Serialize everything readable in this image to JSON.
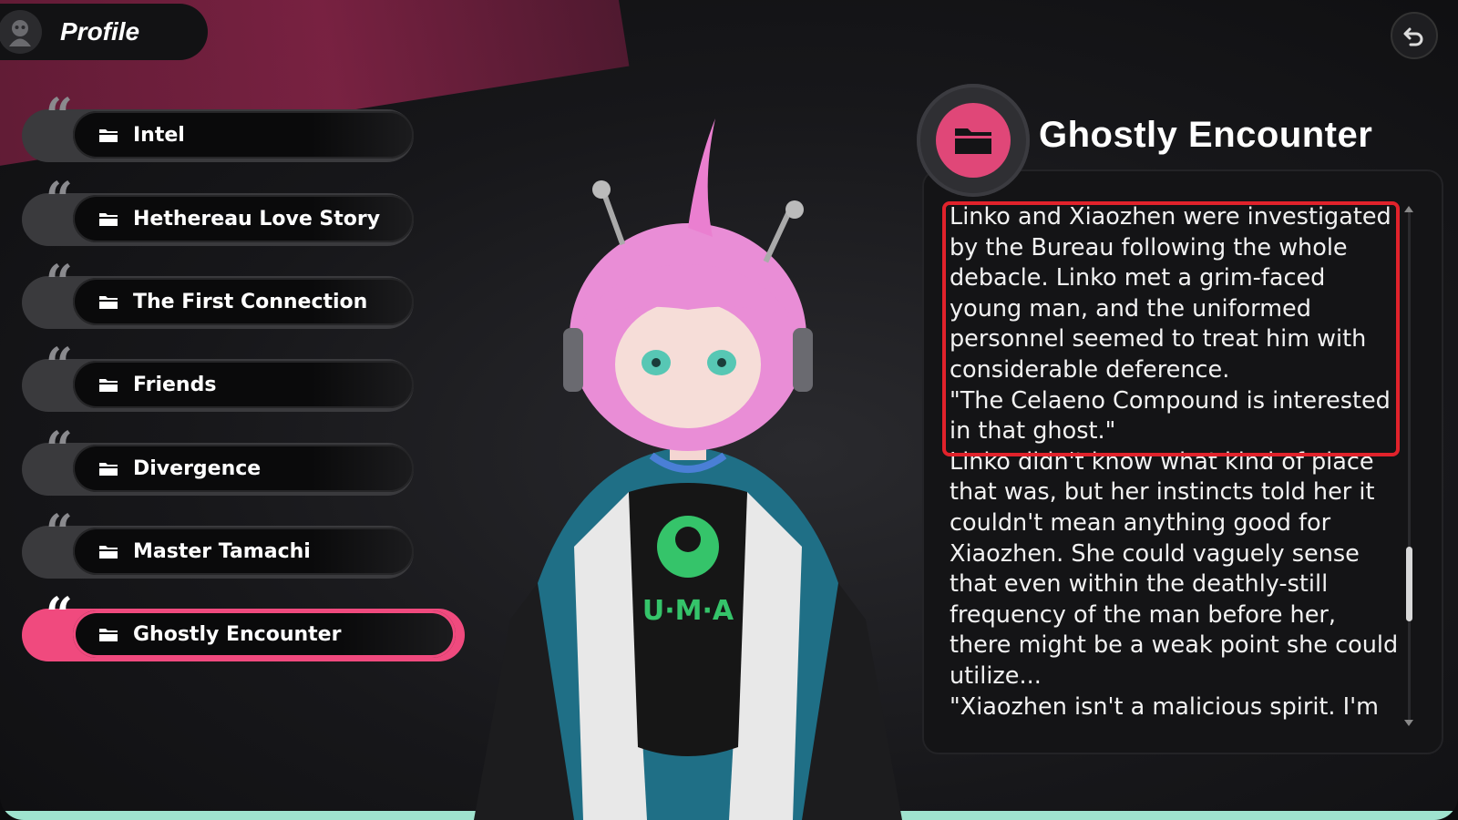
{
  "header": {
    "title": "Profile"
  },
  "entries": [
    {
      "label": "Intel",
      "active": false
    },
    {
      "label": "Hethereau Love Story",
      "active": false
    },
    {
      "label": "The First Connection",
      "active": false
    },
    {
      "label": "Friends",
      "active": false
    },
    {
      "label": "Divergence",
      "active": false
    },
    {
      "label": "Master Tamachi",
      "active": false
    },
    {
      "label": "Ghostly Encounter",
      "active": true
    }
  ],
  "detail": {
    "title": "Ghostly Encounter",
    "paragraphs": [
      "Linko and Xiaozhen were investigated by the Bureau following the whole debacle. Linko met a grim-faced young man, and the uniformed personnel seemed to treat him with considerable deference.",
      "\"The Celaeno Compound is interested in that ghost.\"",
      "Linko didn't know what kind of place that was, but her instincts told her it couldn't mean anything good for Xiaozhen. She could vaguely sense that even within the deathly-still frequency of the man before her, there might be a weak point she could utilize...",
      "\"Xiaozhen isn't a malicious spirit. I'm"
    ]
  },
  "colors": {
    "accent": "#f04a7e",
    "highlight_box": "#e1222b",
    "ribbon": "#8a2449"
  },
  "icons": {
    "back": "undo-arrow-icon",
    "folder": "folder-icon",
    "quote": "quote-mark-icon",
    "profile": "avatar-icon"
  }
}
